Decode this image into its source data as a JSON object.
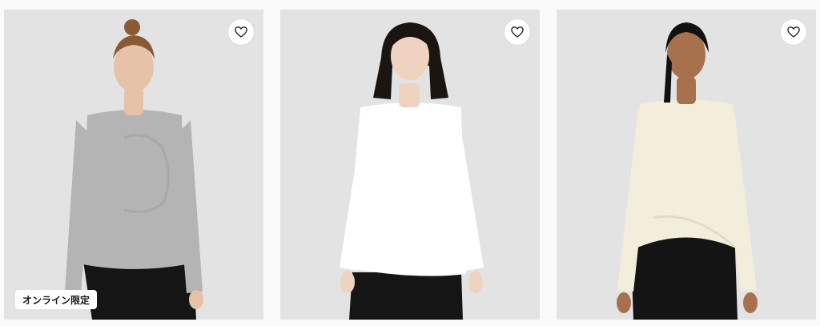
{
  "products": [
    {
      "badge": "オンライン限定",
      "favorite_icon": "heart-icon",
      "top_color": "#b4b4b4",
      "skin_color": "#e6c2a8",
      "hair_color": "#8a5a35",
      "pants_color": "#151515"
    },
    {
      "badge": "",
      "favorite_icon": "heart-icon",
      "top_color": "#ffffff",
      "skin_color": "#efd3c0",
      "hair_color": "#1b1512",
      "pants_color": "#151515"
    },
    {
      "badge": "",
      "favorite_icon": "heart-icon",
      "top_color": "#f3eedb",
      "skin_color": "#a8714e",
      "hair_color": "#121010",
      "pants_color": "#141414"
    }
  ]
}
